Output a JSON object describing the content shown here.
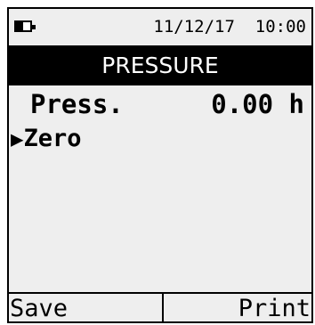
{
  "status": {
    "date": "11/12/17",
    "time": "10:00",
    "battery_level": 0.5,
    "battery_icon": "battery-icon"
  },
  "title": "PRESSURE",
  "reading": {
    "label": "Press.",
    "value": "0.00 h"
  },
  "menu": {
    "selected_marker": "▶",
    "items": [
      {
        "label": "Zero",
        "selected": true
      }
    ]
  },
  "softkeys": {
    "left": "Save",
    "right": "Print"
  }
}
